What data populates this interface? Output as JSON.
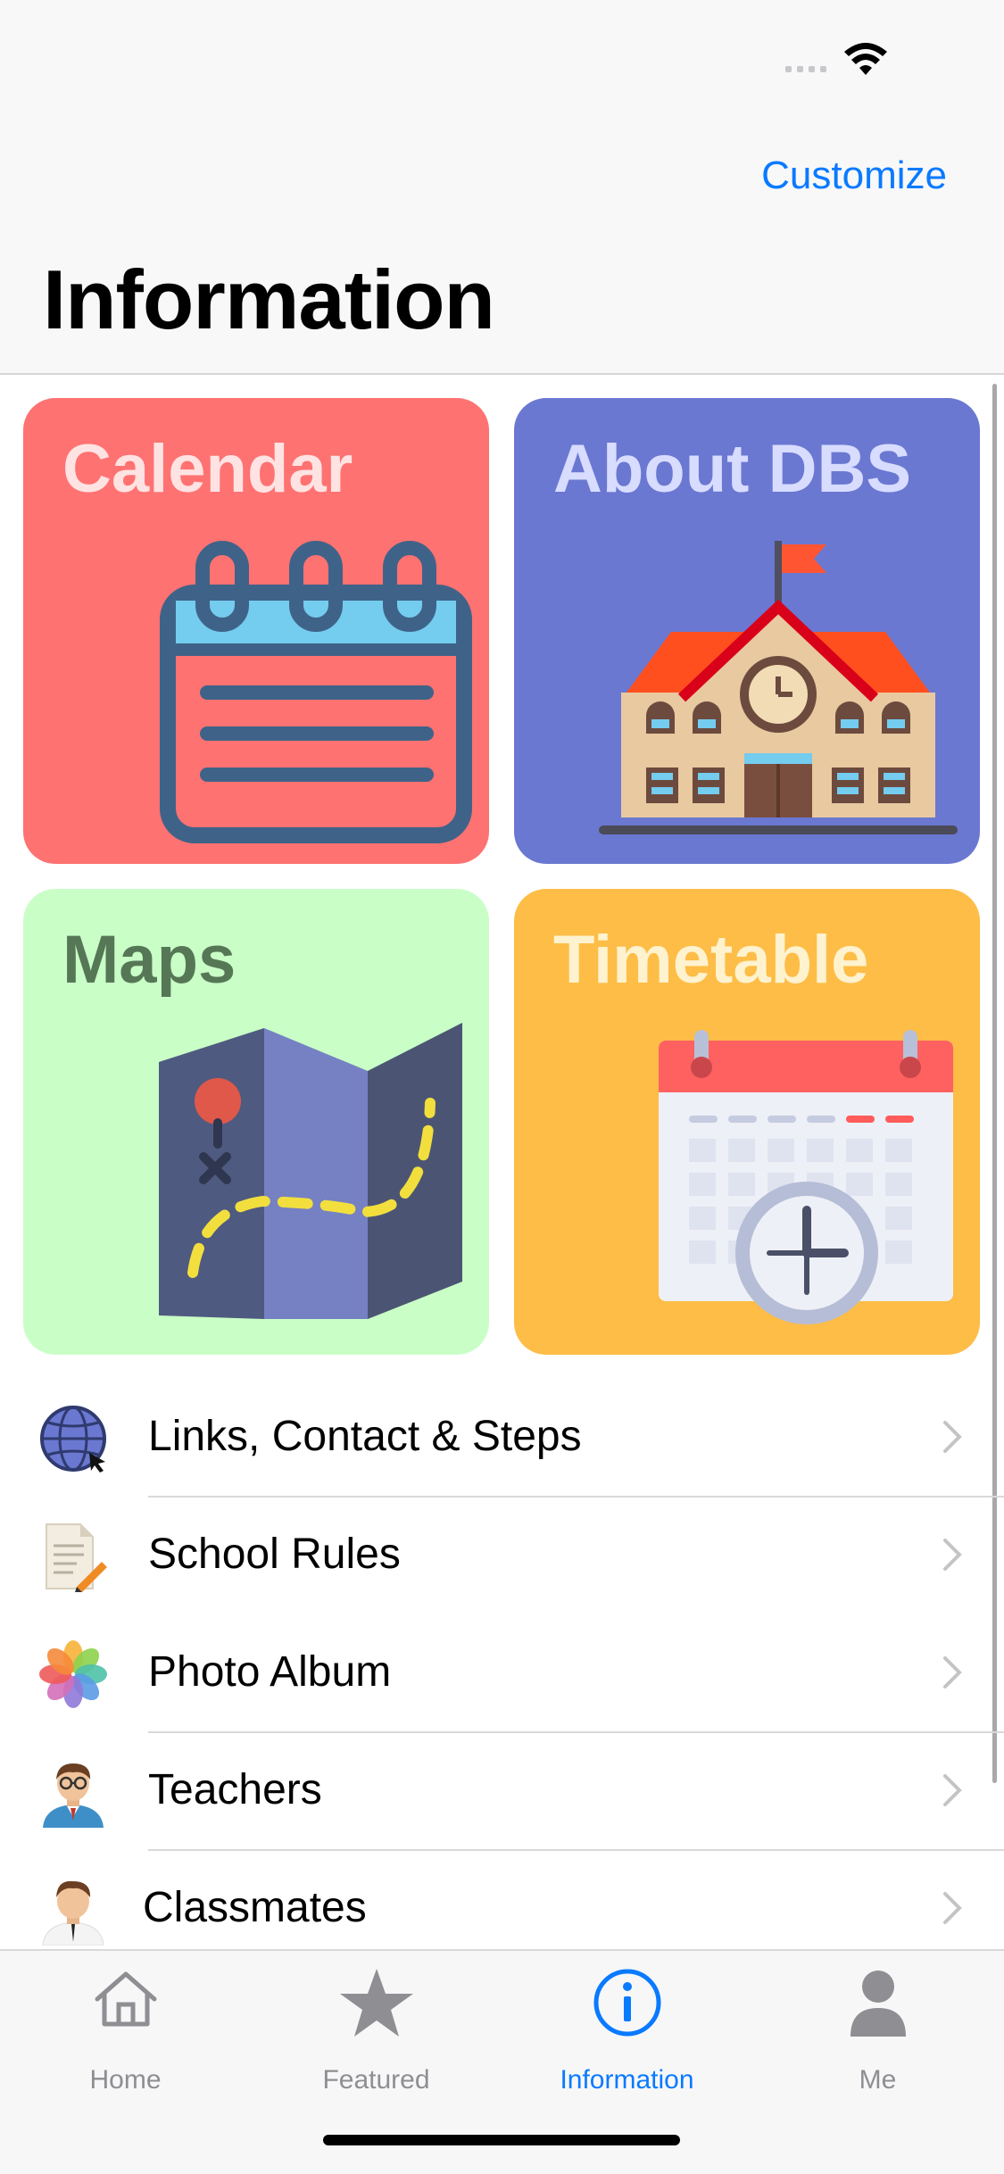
{
  "header": {
    "customize_label": "Customize",
    "title": "Information"
  },
  "tiles": [
    {
      "label": "Calendar",
      "color": "#ff7272"
    },
    {
      "label": "About DBS",
      "color": "#6a78d1"
    },
    {
      "label": "Maps",
      "color": "#c9ffc7"
    },
    {
      "label": "Timetable",
      "color": "#fdbd46"
    }
  ],
  "list": [
    {
      "label": "Links, Contact & Steps",
      "icon": "globe-icon"
    },
    {
      "label": "School Rules",
      "icon": "document-pencil-icon"
    },
    {
      "label": "Photo Album",
      "icon": "photos-flower-icon"
    },
    {
      "label": "Teachers",
      "icon": "teacher-avatar-icon"
    },
    {
      "label": "Classmates",
      "icon": "classmate-avatar-icon"
    }
  ],
  "tabbar": {
    "items": [
      {
        "label": "Home",
        "icon": "house-icon"
      },
      {
        "label": "Featured",
        "icon": "star-icon"
      },
      {
        "label": "Information",
        "icon": "info-circle-icon"
      },
      {
        "label": "Me",
        "icon": "person-icon"
      }
    ],
    "active": "Information",
    "active_color": "#0a7aff",
    "inactive_color": "#8e8e93"
  }
}
